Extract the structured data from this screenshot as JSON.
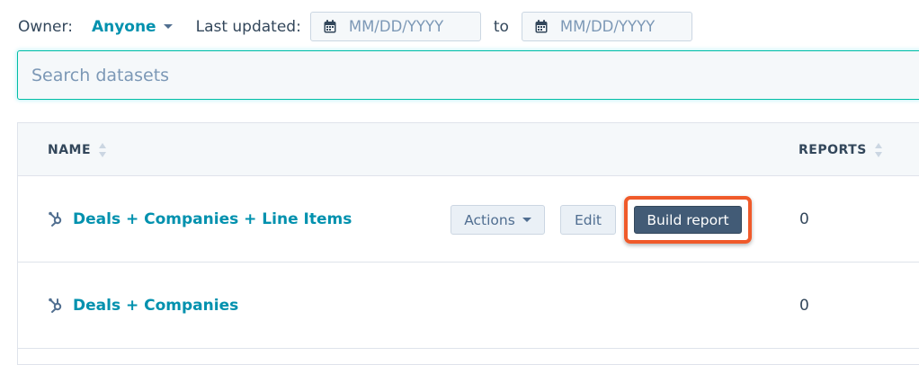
{
  "filters": {
    "owner_label": "Owner:",
    "owner_value": "Anyone",
    "last_updated_label": "Last updated:",
    "date_from_placeholder": "MM/DD/YYYY",
    "to_label": "to",
    "date_to_placeholder": "MM/DD/YYYY"
  },
  "search": {
    "placeholder": "Search datasets",
    "value": ""
  },
  "table": {
    "columns": {
      "name": "NAME",
      "reports": "REPORTS"
    },
    "rows": [
      {
        "name": "Deals + Companies + Line Items",
        "reports": "0",
        "actions_label": "Actions",
        "edit_label": "Edit",
        "build_report_label": "Build report"
      },
      {
        "name": "Deals + Companies",
        "reports": "0"
      }
    ]
  },
  "colors": {
    "accent_link": "#0091ae",
    "search_focus_border": "#00bda5",
    "primary_button": "#425b76",
    "highlight_outline": "#f05a2a"
  },
  "icons": {
    "calendar": "calendar-icon",
    "sort": "sort-icon",
    "dataset": "dataset-icon",
    "dropdown": "chevron-down-icon"
  }
}
